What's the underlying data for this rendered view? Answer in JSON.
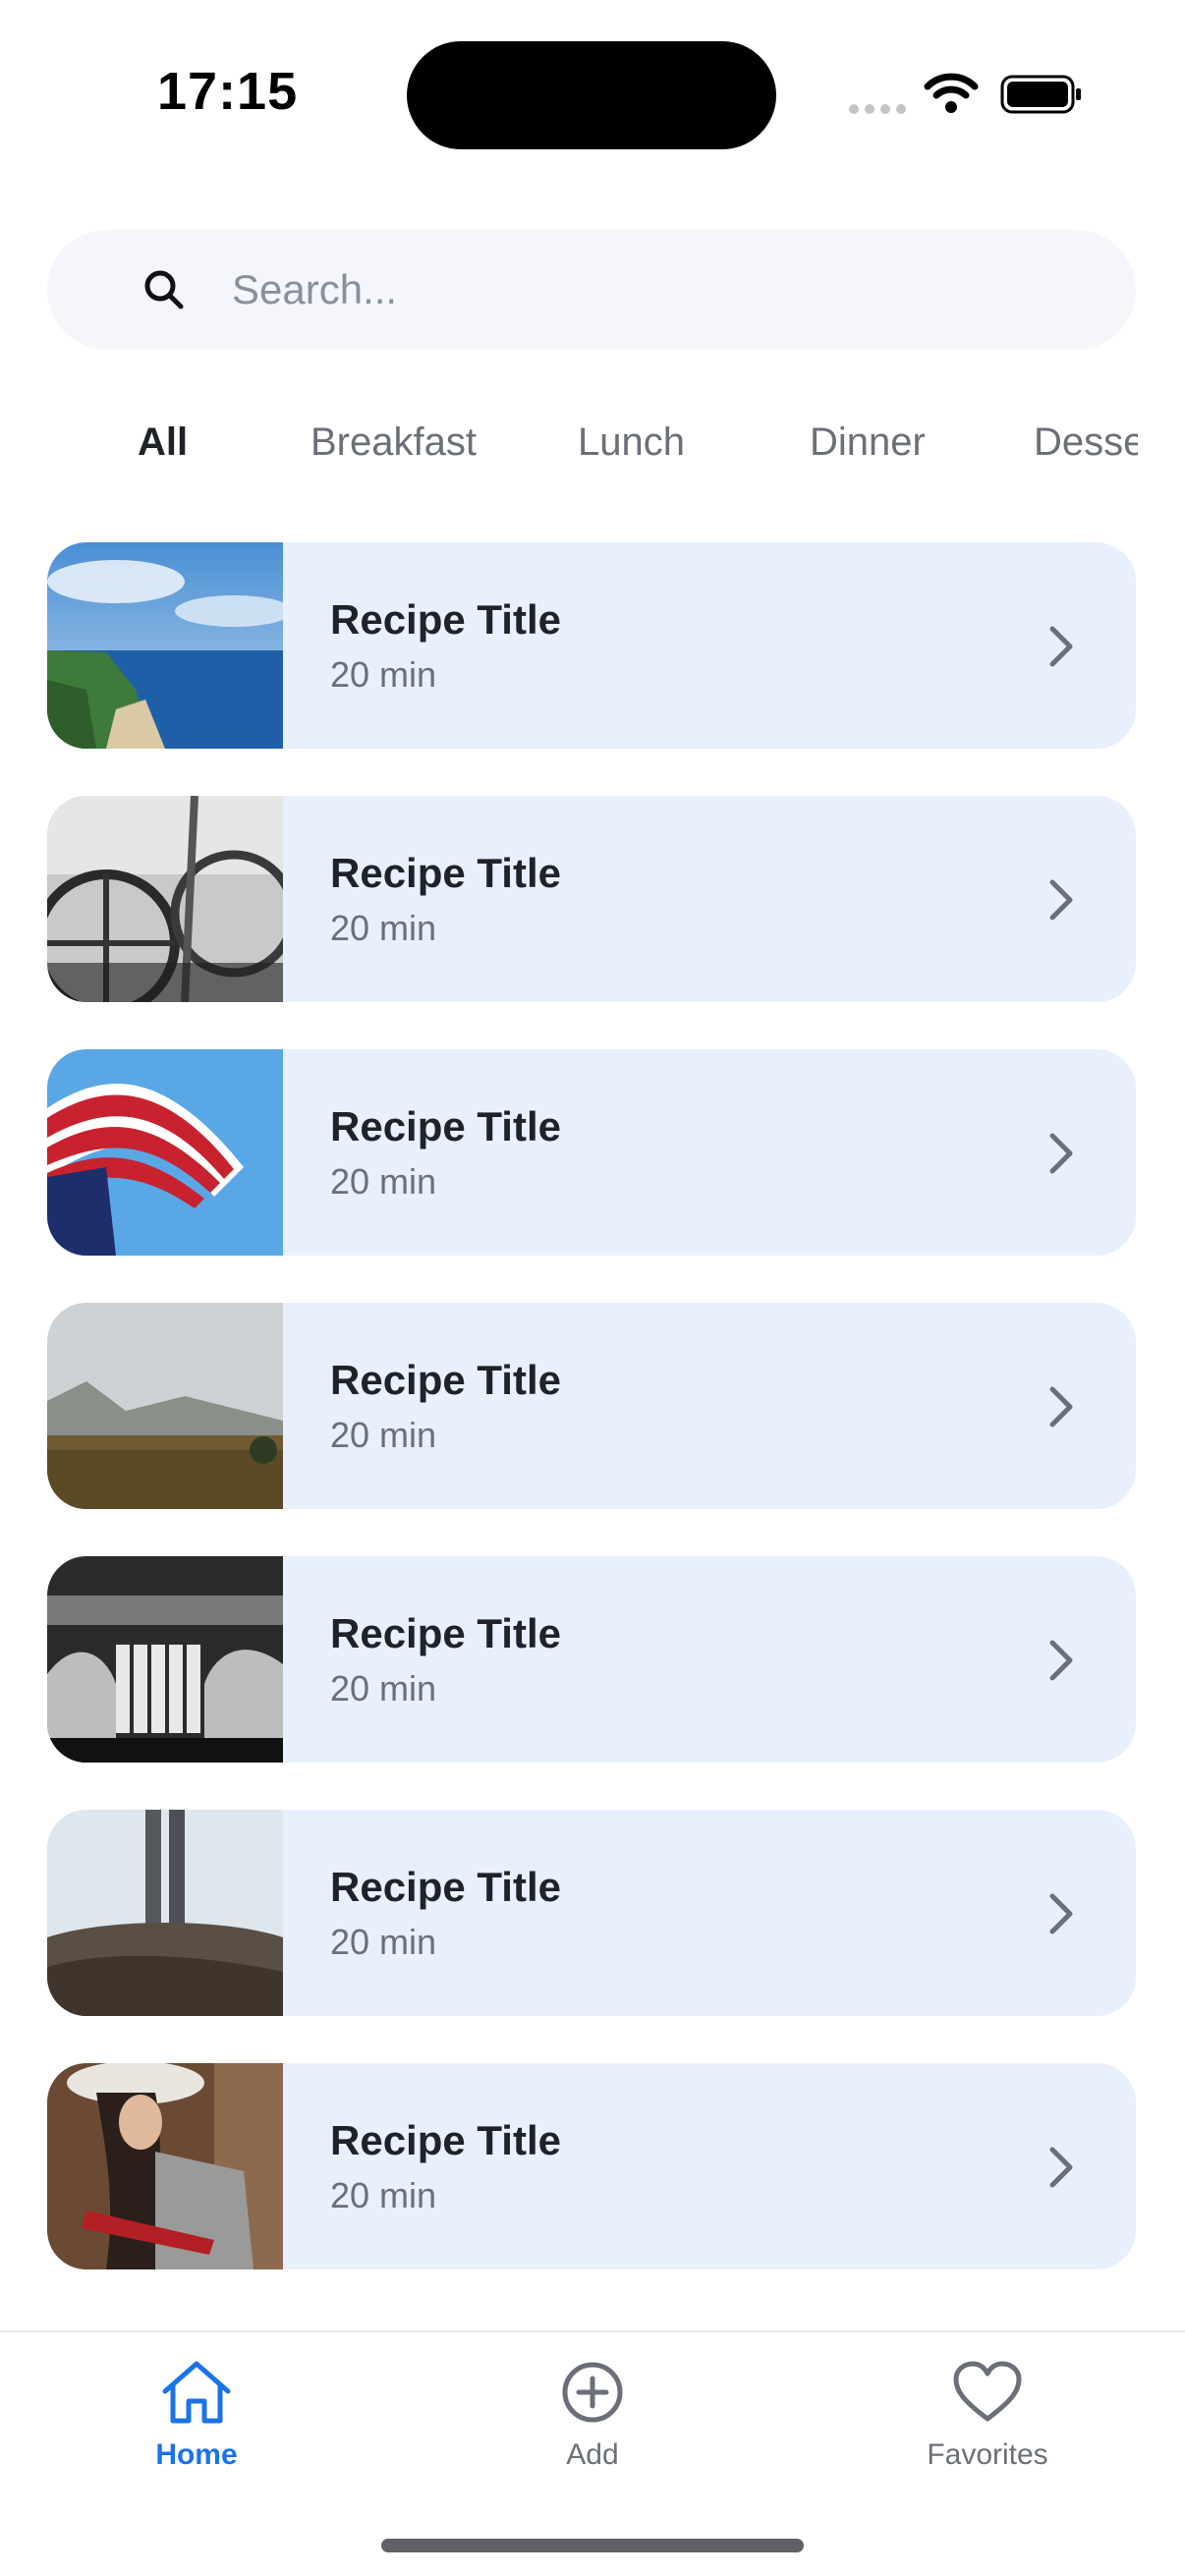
{
  "status_bar": {
    "time": "17:15"
  },
  "search": {
    "placeholder": "Search..."
  },
  "categories": [
    "All",
    "Breakfast",
    "Lunch",
    "Dinner",
    "Dessert"
  ],
  "active_category": "All",
  "recipes": [
    {
      "title": "Recipe Title",
      "time": "20 min",
      "image": "coastal-cliffs-photo"
    },
    {
      "title": "Recipe Title",
      "time": "20 min",
      "image": "black-white-wagon-wheels-photo"
    },
    {
      "title": "Recipe Title",
      "time": "20 min",
      "image": "american-flag-photo"
    },
    {
      "title": "Recipe Title",
      "time": "20 min",
      "image": "mountain-field-photo"
    },
    {
      "title": "Recipe Title",
      "time": "20 min",
      "image": "piano-hands-photo"
    },
    {
      "title": "Recipe Title",
      "time": "20 min",
      "image": "legs-on-rocks-photo"
    },
    {
      "title": "Recipe Title",
      "time": "20 min",
      "image": "woman-guitar-photo"
    }
  ],
  "tabbar": {
    "home": "Home",
    "add": "Add",
    "favorites": "Favorites",
    "active": "Home"
  },
  "colors": {
    "accent": "#1a73e8",
    "card_bg": "#e8f0fe",
    "search_bg": "#f4f6fc"
  }
}
